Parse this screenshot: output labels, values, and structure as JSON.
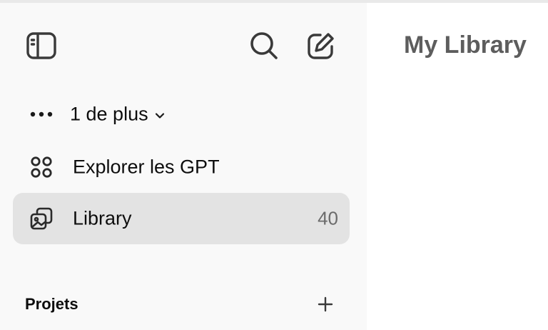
{
  "sidebar": {
    "toggle_icon": "sidebar-toggle-icon",
    "search_icon": "search-icon",
    "new_chat_icon": "new-chat-icon",
    "more": {
      "icon": "ellipsis-icon",
      "label": "1 de plus",
      "chevron_icon": "chevron-down-icon"
    },
    "items": [
      {
        "icon": "grid-dots-icon",
        "label": "Explorer les GPT"
      },
      {
        "icon": "images-icon",
        "label": "Library",
        "count": "40",
        "active": true
      }
    ],
    "projects": {
      "title": "Projets",
      "add_icon": "plus-icon"
    }
  },
  "main": {
    "title": "My Library"
  },
  "colors": {
    "sidebar_bg": "#f9f9f9",
    "active_item_bg": "#e3e3e3",
    "text": "#0d0d0d",
    "muted": "#6b6b6b",
    "title": "#5d5d5d"
  }
}
